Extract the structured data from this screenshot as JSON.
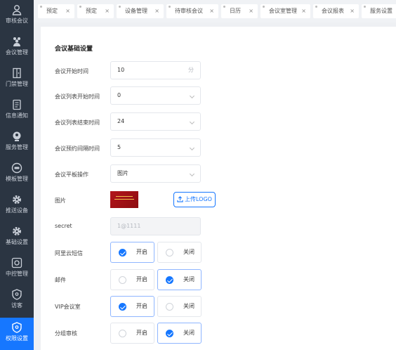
{
  "sidebar": {
    "items": [
      {
        "label": "审核会议",
        "icon": "user-check-icon"
      },
      {
        "label": "会议管理",
        "icon": "users-icon"
      },
      {
        "label": "门禁管理",
        "icon": "door-icon"
      },
      {
        "label": "信息通知",
        "icon": "document-icon"
      },
      {
        "label": "服务管理",
        "icon": "service-icon"
      },
      {
        "label": "模板管理",
        "icon": "template-icon"
      },
      {
        "label": "推送设备",
        "icon": "gear-icon"
      },
      {
        "label": "基础设置",
        "icon": "gear-icon"
      },
      {
        "label": "中控管理",
        "icon": "control-icon"
      },
      {
        "label": "访客",
        "icon": "shield-icon"
      },
      {
        "label": "权限设置",
        "icon": "shield-icon"
      }
    ],
    "active_index": 10,
    "active_color": "#1677ff"
  },
  "tabs": [
    {
      "label": "预定",
      "close": "×"
    },
    {
      "label": "预定",
      "close": "×"
    },
    {
      "label": "设备管理",
      "close": "×"
    },
    {
      "label": "待审核会议",
      "close": "×"
    },
    {
      "label": "日历",
      "close": "×"
    },
    {
      "label": "会议室管理",
      "close": "×"
    },
    {
      "label": "会议报表",
      "close": "×"
    },
    {
      "label": "服务设置",
      "close": ""
    }
  ],
  "form": {
    "title": "会议基础设置",
    "rows": {
      "start_time": {
        "label": "会议开始时间",
        "value": "10",
        "suffix": "分"
      },
      "list_start": {
        "label": "会议列表开始时间",
        "value": "0"
      },
      "list_end": {
        "label": "会议列表结束时间",
        "value": "24"
      },
      "interval": {
        "label": "会议预约间隔时间",
        "value": "5"
      },
      "tablet_op": {
        "label": "会议平板操作",
        "value": "图片"
      },
      "image": {
        "label": "图片",
        "upload_label": "上传LOGO"
      },
      "secret": {
        "label": "secret",
        "value": "1@1111"
      },
      "aliyun_sms": {
        "label": "阿里云短信",
        "on": "开启",
        "off": "关闭",
        "selected": "on"
      },
      "email": {
        "label": "邮件",
        "on": "开启",
        "off": "关闭",
        "selected": "off"
      },
      "vip_room": {
        "label": "VIP会议室",
        "on": "开启",
        "off": "关闭",
        "selected": "on"
      },
      "group_review": {
        "label": "分组审核",
        "on": "开启",
        "off": "关闭",
        "selected": "off"
      }
    }
  }
}
